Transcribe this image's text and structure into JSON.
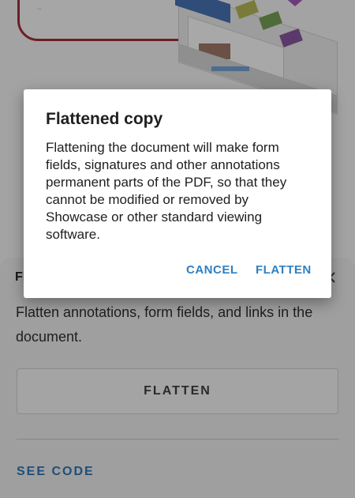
{
  "background_document": {
    "cloud_text": "..."
  },
  "bottom_sheet": {
    "title": "Fl",
    "close_icon": "close-icon",
    "description": "Flatten annotations, form fields, and links in the document.",
    "button_label": "FLATTEN",
    "see_code_label": "SEE CODE"
  },
  "dialog": {
    "title": "Flattened copy",
    "body": "Flattening the document will make form fields, signatures and other annotations permanent parts of the PDF, so that they cannot be modified or removed by Showcase or other standard viewing software.",
    "cancel_label": "CANCEL",
    "flatten_label": "FLATTEN"
  },
  "colors": {
    "dialog_bg": "#ffffff",
    "accent": "#2f7fc1",
    "scrim": "#9a9a9a"
  }
}
